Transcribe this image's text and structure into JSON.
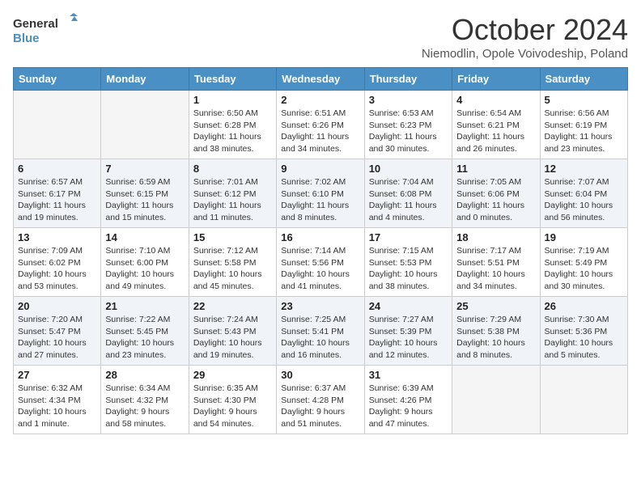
{
  "header": {
    "logo_general": "General",
    "logo_blue": "Blue",
    "month_title": "October 2024",
    "subtitle": "Niemodlin, Opole Voivodeship, Poland"
  },
  "weekdays": [
    "Sunday",
    "Monday",
    "Tuesday",
    "Wednesday",
    "Thursday",
    "Friday",
    "Saturday"
  ],
  "weeks": [
    [
      {
        "day": null,
        "sunrise": null,
        "sunset": null,
        "daylight": null
      },
      {
        "day": null,
        "sunrise": null,
        "sunset": null,
        "daylight": null
      },
      {
        "day": "1",
        "sunrise": "Sunrise: 6:50 AM",
        "sunset": "Sunset: 6:28 PM",
        "daylight": "Daylight: 11 hours and 38 minutes."
      },
      {
        "day": "2",
        "sunrise": "Sunrise: 6:51 AM",
        "sunset": "Sunset: 6:26 PM",
        "daylight": "Daylight: 11 hours and 34 minutes."
      },
      {
        "day": "3",
        "sunrise": "Sunrise: 6:53 AM",
        "sunset": "Sunset: 6:23 PM",
        "daylight": "Daylight: 11 hours and 30 minutes."
      },
      {
        "day": "4",
        "sunrise": "Sunrise: 6:54 AM",
        "sunset": "Sunset: 6:21 PM",
        "daylight": "Daylight: 11 hours and 26 minutes."
      },
      {
        "day": "5",
        "sunrise": "Sunrise: 6:56 AM",
        "sunset": "Sunset: 6:19 PM",
        "daylight": "Daylight: 11 hours and 23 minutes."
      }
    ],
    [
      {
        "day": "6",
        "sunrise": "Sunrise: 6:57 AM",
        "sunset": "Sunset: 6:17 PM",
        "daylight": "Daylight: 11 hours and 19 minutes."
      },
      {
        "day": "7",
        "sunrise": "Sunrise: 6:59 AM",
        "sunset": "Sunset: 6:15 PM",
        "daylight": "Daylight: 11 hours and 15 minutes."
      },
      {
        "day": "8",
        "sunrise": "Sunrise: 7:01 AM",
        "sunset": "Sunset: 6:12 PM",
        "daylight": "Daylight: 11 hours and 11 minutes."
      },
      {
        "day": "9",
        "sunrise": "Sunrise: 7:02 AM",
        "sunset": "Sunset: 6:10 PM",
        "daylight": "Daylight: 11 hours and 8 minutes."
      },
      {
        "day": "10",
        "sunrise": "Sunrise: 7:04 AM",
        "sunset": "Sunset: 6:08 PM",
        "daylight": "Daylight: 11 hours and 4 minutes."
      },
      {
        "day": "11",
        "sunrise": "Sunrise: 7:05 AM",
        "sunset": "Sunset: 6:06 PM",
        "daylight": "Daylight: 11 hours and 0 minutes."
      },
      {
        "day": "12",
        "sunrise": "Sunrise: 7:07 AM",
        "sunset": "Sunset: 6:04 PM",
        "daylight": "Daylight: 10 hours and 56 minutes."
      }
    ],
    [
      {
        "day": "13",
        "sunrise": "Sunrise: 7:09 AM",
        "sunset": "Sunset: 6:02 PM",
        "daylight": "Daylight: 10 hours and 53 minutes."
      },
      {
        "day": "14",
        "sunrise": "Sunrise: 7:10 AM",
        "sunset": "Sunset: 6:00 PM",
        "daylight": "Daylight: 10 hours and 49 minutes."
      },
      {
        "day": "15",
        "sunrise": "Sunrise: 7:12 AM",
        "sunset": "Sunset: 5:58 PM",
        "daylight": "Daylight: 10 hours and 45 minutes."
      },
      {
        "day": "16",
        "sunrise": "Sunrise: 7:14 AM",
        "sunset": "Sunset: 5:56 PM",
        "daylight": "Daylight: 10 hours and 41 minutes."
      },
      {
        "day": "17",
        "sunrise": "Sunrise: 7:15 AM",
        "sunset": "Sunset: 5:53 PM",
        "daylight": "Daylight: 10 hours and 38 minutes."
      },
      {
        "day": "18",
        "sunrise": "Sunrise: 7:17 AM",
        "sunset": "Sunset: 5:51 PM",
        "daylight": "Daylight: 10 hours and 34 minutes."
      },
      {
        "day": "19",
        "sunrise": "Sunrise: 7:19 AM",
        "sunset": "Sunset: 5:49 PM",
        "daylight": "Daylight: 10 hours and 30 minutes."
      }
    ],
    [
      {
        "day": "20",
        "sunrise": "Sunrise: 7:20 AM",
        "sunset": "Sunset: 5:47 PM",
        "daylight": "Daylight: 10 hours and 27 minutes."
      },
      {
        "day": "21",
        "sunrise": "Sunrise: 7:22 AM",
        "sunset": "Sunset: 5:45 PM",
        "daylight": "Daylight: 10 hours and 23 minutes."
      },
      {
        "day": "22",
        "sunrise": "Sunrise: 7:24 AM",
        "sunset": "Sunset: 5:43 PM",
        "daylight": "Daylight: 10 hours and 19 minutes."
      },
      {
        "day": "23",
        "sunrise": "Sunrise: 7:25 AM",
        "sunset": "Sunset: 5:41 PM",
        "daylight": "Daylight: 10 hours and 16 minutes."
      },
      {
        "day": "24",
        "sunrise": "Sunrise: 7:27 AM",
        "sunset": "Sunset: 5:39 PM",
        "daylight": "Daylight: 10 hours and 12 minutes."
      },
      {
        "day": "25",
        "sunrise": "Sunrise: 7:29 AM",
        "sunset": "Sunset: 5:38 PM",
        "daylight": "Daylight: 10 hours and 8 minutes."
      },
      {
        "day": "26",
        "sunrise": "Sunrise: 7:30 AM",
        "sunset": "Sunset: 5:36 PM",
        "daylight": "Daylight: 10 hours and 5 minutes."
      }
    ],
    [
      {
        "day": "27",
        "sunrise": "Sunrise: 6:32 AM",
        "sunset": "Sunset: 4:34 PM",
        "daylight": "Daylight: 10 hours and 1 minute."
      },
      {
        "day": "28",
        "sunrise": "Sunrise: 6:34 AM",
        "sunset": "Sunset: 4:32 PM",
        "daylight": "Daylight: 9 hours and 58 minutes."
      },
      {
        "day": "29",
        "sunrise": "Sunrise: 6:35 AM",
        "sunset": "Sunset: 4:30 PM",
        "daylight": "Daylight: 9 hours and 54 minutes."
      },
      {
        "day": "30",
        "sunrise": "Sunrise: 6:37 AM",
        "sunset": "Sunset: 4:28 PM",
        "daylight": "Daylight: 9 hours and 51 minutes."
      },
      {
        "day": "31",
        "sunrise": "Sunrise: 6:39 AM",
        "sunset": "Sunset: 4:26 PM",
        "daylight": "Daylight: 9 hours and 47 minutes."
      },
      {
        "day": null,
        "sunrise": null,
        "sunset": null,
        "daylight": null
      },
      {
        "day": null,
        "sunrise": null,
        "sunset": null,
        "daylight": null
      }
    ]
  ]
}
